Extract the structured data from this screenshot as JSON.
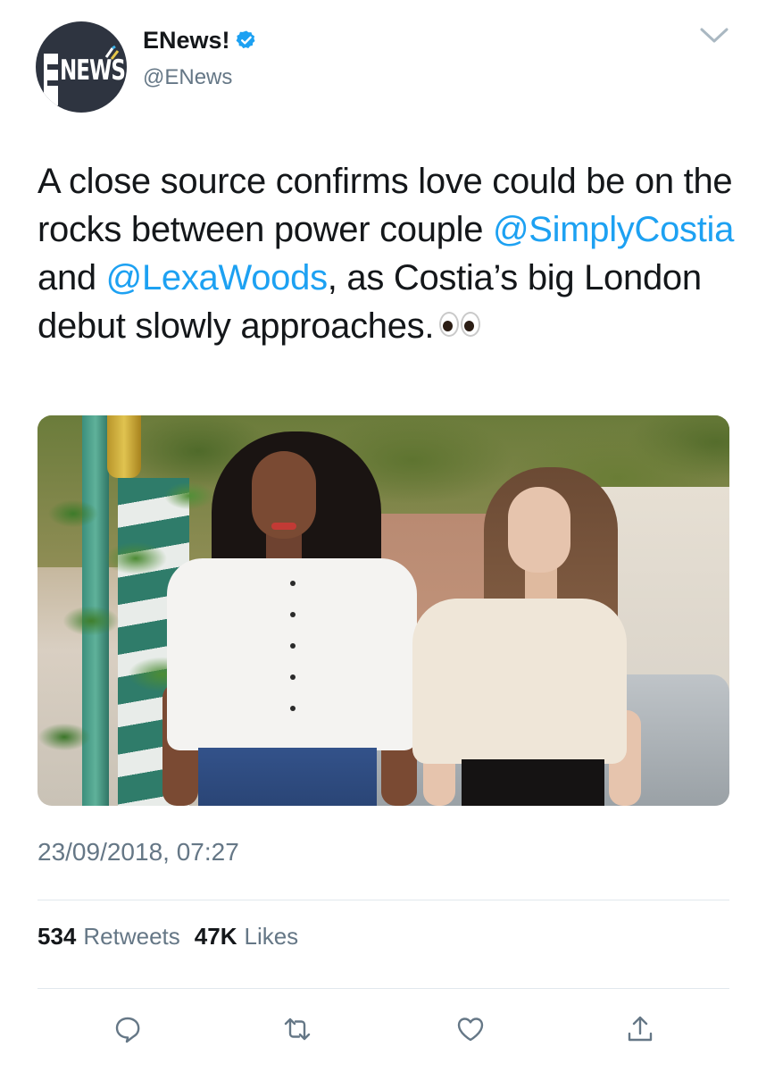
{
  "author": {
    "display_name": "ENews!",
    "handle": "@ENews",
    "avatar_text": "NEWS",
    "verified_icon": "verified-badge-icon",
    "brand_color": "#1da1f2"
  },
  "tweet": {
    "text_parts": {
      "p1": "A close source confirms love could be on the rocks between power couple ",
      "mention1": "@SimplyCostia",
      "p2": " and ",
      "mention2": "@LexaWoods",
      "p3": ", as Costia’s big London debut slowly approaches."
    },
    "emoji": "eyes-emoji",
    "timestamp": "23/09/2018, 07:27"
  },
  "stats": {
    "retweets_count": "534",
    "retweets_label": "Retweets",
    "likes_count": "47K",
    "likes_label": "Likes"
  },
  "actions": [
    {
      "name": "reply",
      "icon": "reply-icon"
    },
    {
      "name": "retweet",
      "icon": "retweet-icon"
    },
    {
      "name": "like",
      "icon": "heart-icon"
    },
    {
      "name": "share",
      "icon": "share-icon"
    }
  ],
  "colors": {
    "text": "#14171a",
    "secondary": "#657786",
    "link": "#1da1f2",
    "divider": "#e1e8ed"
  }
}
